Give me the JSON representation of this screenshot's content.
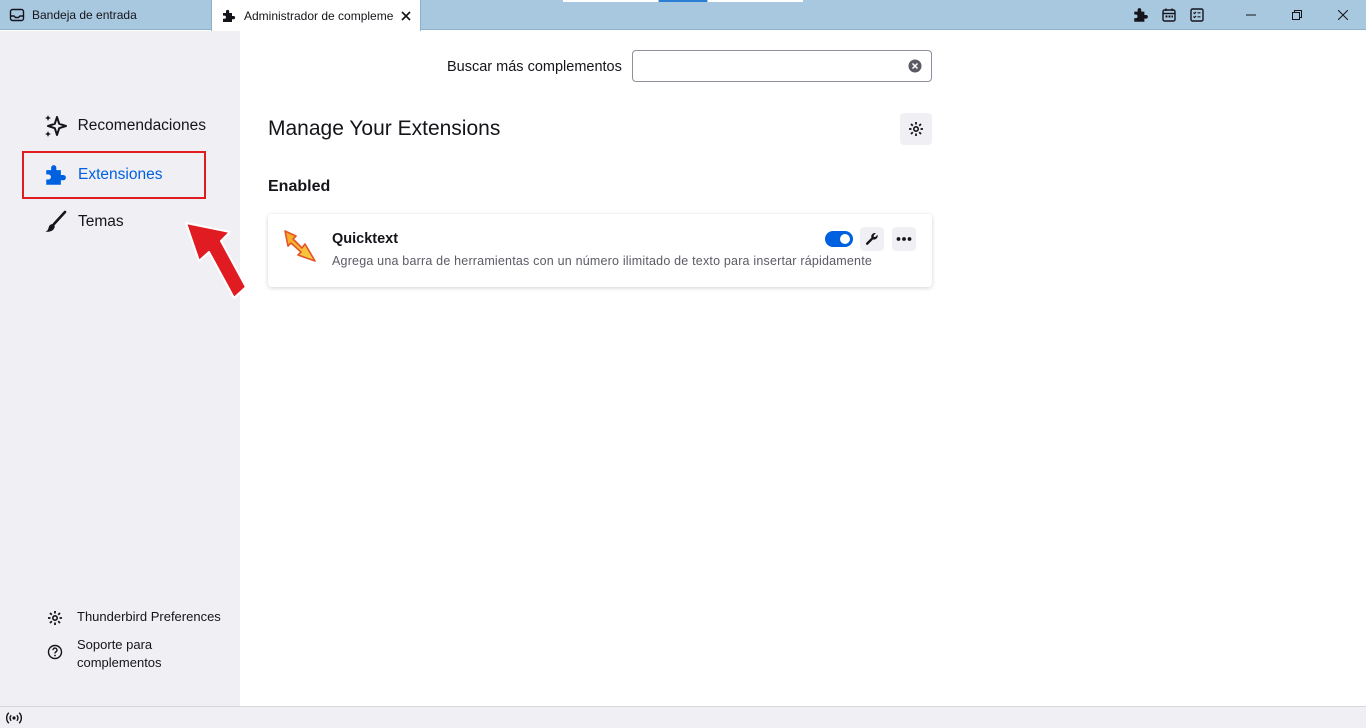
{
  "titlebar": {
    "tabs": [
      {
        "label": "Bandeja de entrada",
        "icon": "inbox-icon"
      },
      {
        "label": "Administrador de complementos",
        "icon": "puzzle-icon",
        "active": true
      }
    ],
    "toolbar_icons": [
      "puzzle-icon",
      "calendar-icon",
      "tasks-icon"
    ],
    "window_controls": [
      "minimize-icon",
      "maximize-icon",
      "close-icon"
    ]
  },
  "sidebar": {
    "categories": [
      {
        "label": "Recomendaciones",
        "icon": "sparkle-icon"
      },
      {
        "label": "Extensiones",
        "icon": "puzzle-icon",
        "selected": true
      },
      {
        "label": "Temas",
        "icon": "brush-icon"
      }
    ],
    "footer": {
      "preferences": "Thunderbird Preferences",
      "support_line1": "Soporte para",
      "support_line2": "complementos"
    }
  },
  "main": {
    "search": {
      "label": "Buscar más complementos",
      "value": "",
      "placeholder": ""
    },
    "page_title": "Manage Your Extensions",
    "section_heading": "Enabled",
    "addons": [
      {
        "name": "Quicktext",
        "description": "Agrega una barra de herramientas con un número ilimitado de texto para insertar rápidamente",
        "enabled": true
      }
    ]
  },
  "colors": {
    "accent": "#0061e0",
    "annotation": "#e11b22",
    "titlebar": "#a8c8e0",
    "sidebar": "#f0f0f4"
  }
}
